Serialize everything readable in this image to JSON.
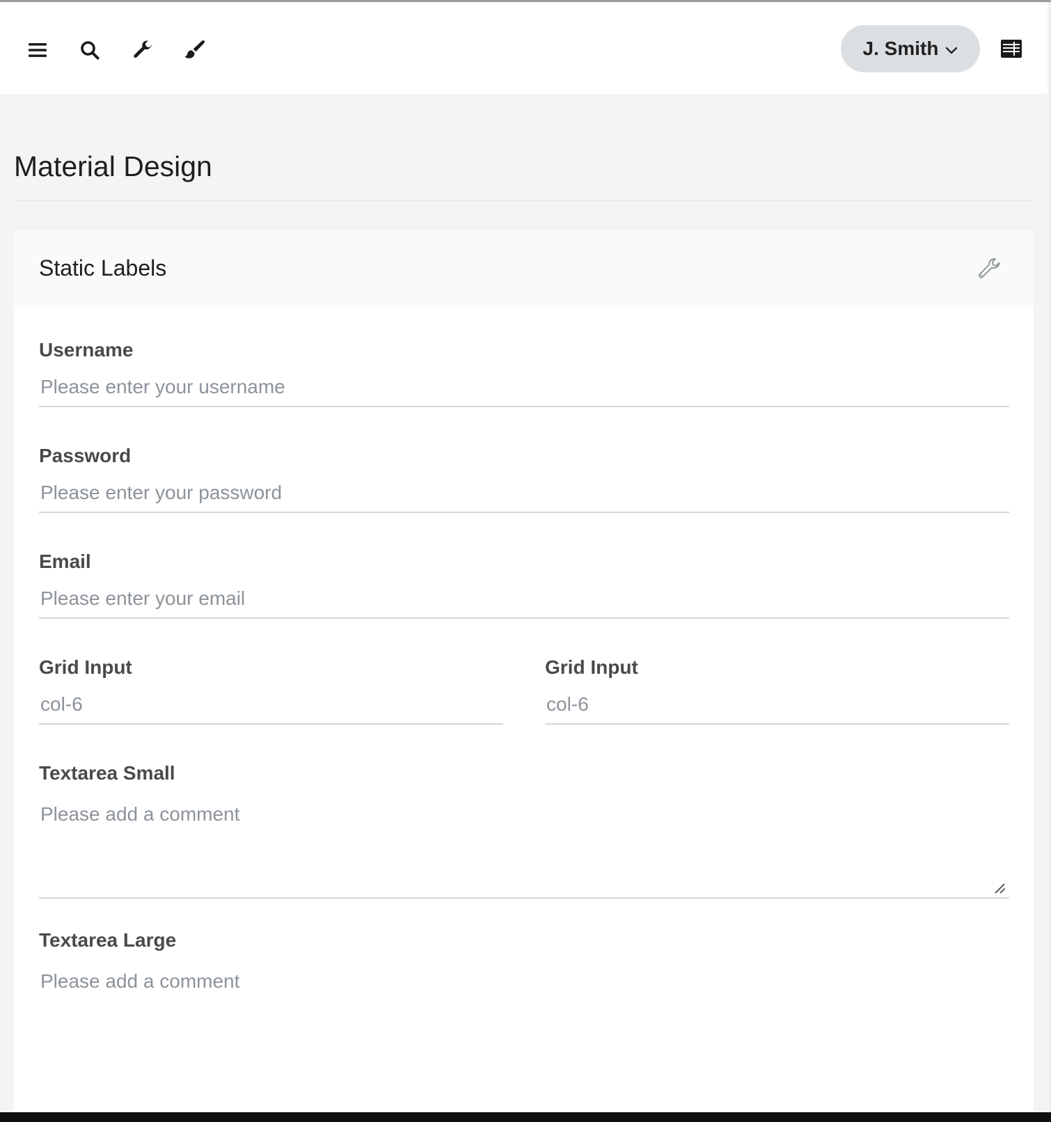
{
  "header": {
    "icons": [
      "menu-icon",
      "search-icon",
      "wrench-icon",
      "paint-brush-icon"
    ],
    "user_name": "J. Smith",
    "right_icon": "sidebar-toggle-icon"
  },
  "page": {
    "title": "Material Design"
  },
  "card": {
    "title": "Static Labels",
    "tool_icon": "wrench-outline-icon",
    "fields": {
      "username": {
        "label": "Username",
        "placeholder": "Please enter your username"
      },
      "password": {
        "label": "Password",
        "placeholder": "Please enter your password"
      },
      "email": {
        "label": "Email",
        "placeholder": "Please enter your email"
      },
      "grid_left": {
        "label": "Grid Input",
        "placeholder": "col-6"
      },
      "grid_right": {
        "label": "Grid Input",
        "placeholder": "col-6"
      },
      "textarea_small": {
        "label": "Textarea Small",
        "placeholder": "Please add a comment"
      },
      "textarea_large": {
        "label": "Textarea Large",
        "placeholder": "Please add a comment"
      }
    }
  },
  "colors": {
    "page_bg": "#f3f4f6",
    "card_bg": "#ffffff",
    "user_pill": "#dcdfe2",
    "placeholder": "#8d939a"
  }
}
